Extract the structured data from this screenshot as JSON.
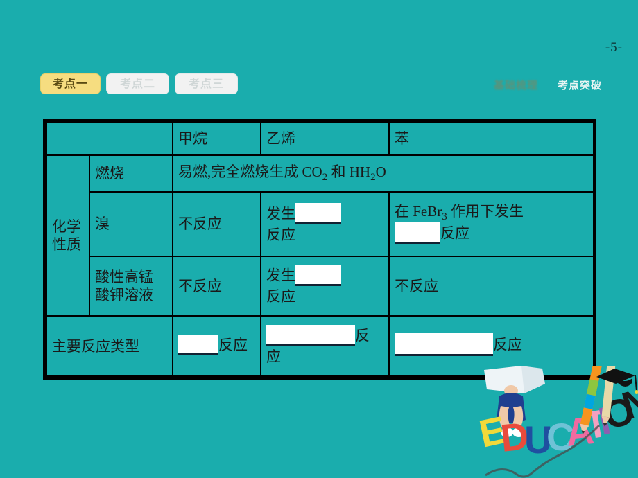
{
  "page": {
    "number": "-5-"
  },
  "tabs": [
    {
      "label": "考点一",
      "state": "active"
    },
    {
      "label": "考点二",
      "state": "inactive"
    },
    {
      "label": "考点三",
      "state": "inactive"
    }
  ],
  "header_right": {
    "faded_label": "基础梳理",
    "plain_label": "考点突破"
  },
  "decoration": {
    "word": "EDUCATION",
    "letter_colors": [
      "#f2d93a",
      "#e94b3c",
      "#1f4fa0",
      "#6fc2d6",
      "#f06aa0",
      "#f4a0c0",
      "#8e5fb0",
      "#f7941e",
      "#1a1a1a"
    ]
  },
  "table": {
    "columns": [
      "",
      "",
      "甲烷",
      "乙烯",
      "苯"
    ],
    "row_group_label": "化学性质",
    "rows": [
      {
        "label": "燃烧",
        "span_all": true,
        "span_text": "易燃,完全燃烧生成 CO",
        "span_sub1": "2",
        "span_mid": " 和 H",
        "span_sub2": "2",
        "span_end": "O"
      },
      {
        "label": "溴",
        "methane": "不反应",
        "ethylene_pre": "发生",
        "ethylene_blank": "",
        "ethylene_post": "反应",
        "benzene_pre": "在 FeBr",
        "benzene_sub": "3",
        "benzene_mid": " 作用下发生",
        "benzene_blank": "",
        "benzene_post": "反应"
      },
      {
        "label": "酸性高锰酸钾溶液",
        "methane": "不反应",
        "ethylene_pre": "发生",
        "ethylene_blank": "",
        "ethylene_post": "反应",
        "benzene": "不反应"
      }
    ],
    "last_row": {
      "label": "主要反应类型",
      "methane_blank": "",
      "methane_post": "反应",
      "ethylene_blank": "",
      "ethylene_post": "反应",
      "benzene_blank": "",
      "benzene_post": "反应"
    }
  }
}
